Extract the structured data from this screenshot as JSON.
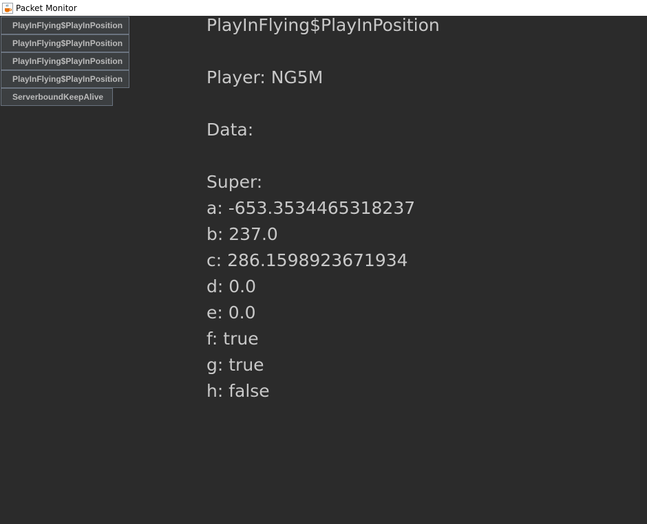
{
  "window": {
    "title": "Packet Monitor"
  },
  "packet_list": {
    "items": [
      {
        "label": "PlayInFlying$PlayInPosition"
      },
      {
        "label": "PlayInFlying$PlayInPosition"
      },
      {
        "label": "PlayInFlying$PlayInPosition"
      },
      {
        "label": "PlayInFlying$PlayInPosition"
      },
      {
        "label": "ServerboundKeepAlive"
      }
    ]
  },
  "details": {
    "packet_name": "PlayInFlying$PlayInPosition",
    "player": "Player: NG5M",
    "data_header": "Data:",
    "super_header": "Super:",
    "fields": [
      "a: -653.3534465318237",
      "b: 237.0",
      "c: 286.1598923671934",
      "d: 0.0",
      "e: 0.0",
      "f: true",
      "g: true",
      "h: false"
    ]
  },
  "colors": {
    "background": "#2b2b2b",
    "button_bg": "#3c3f41",
    "button_border": "#6b7480",
    "text": "#c8c8c8"
  },
  "icons": {
    "app": "java-coffee-cup-icon"
  }
}
